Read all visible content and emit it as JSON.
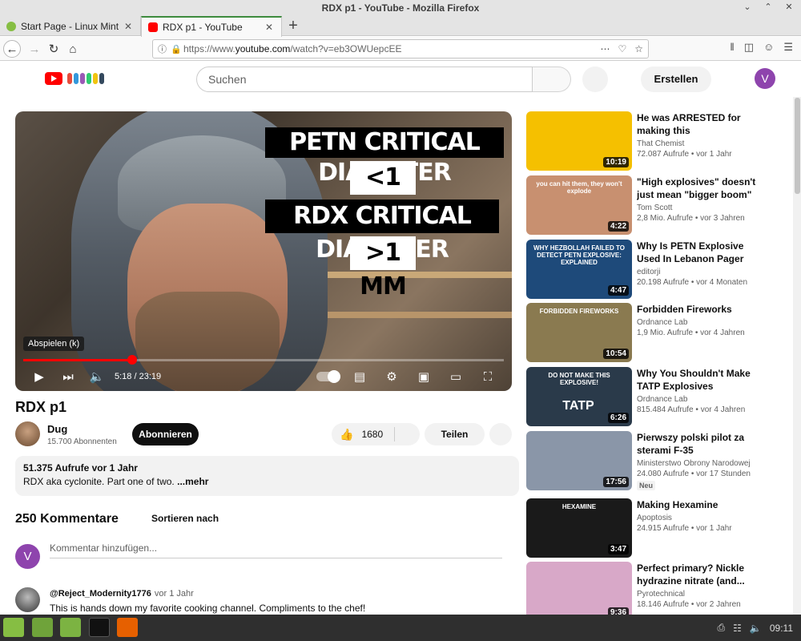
{
  "window": {
    "title": "RDX p1 - YouTube - Mozilla Firefox"
  },
  "browser": {
    "tabs": [
      {
        "label": "Start Page - Linux Mint",
        "active": false
      },
      {
        "label": "RDX p1 - YouTube",
        "active": true
      }
    ],
    "url_prefix": "https://www.",
    "url_domain": "youtube.com",
    "url_path": "/watch?v=eb3OWUepcEE"
  },
  "youtube": {
    "search_placeholder": "Suchen",
    "create_label": "Erstellen",
    "user_initial": "V"
  },
  "video": {
    "overlay_lines": [
      "PETN CRITICAL DIAMETER",
      "<1 MM",
      "RDX CRITICAL DIAMETER",
      ">1 MM"
    ],
    "tooltip": "Abspielen (k)",
    "time": "5:18 / 23:19",
    "progress": 0.2273,
    "title": "RDX p1"
  },
  "channel": {
    "name": "Dug",
    "subscribers": "15.700 Abonnenten",
    "subscribe_label": "Abonnieren"
  },
  "actions": {
    "likes": "1680",
    "share_label": "Teilen"
  },
  "description": {
    "meta": "51.375 Aufrufe  vor 1 Jahr",
    "text": "RDX aka cyclonite. Part one of two.",
    "more": "...mehr"
  },
  "comments": {
    "count": "250 Kommentare",
    "sort_label": "Sortieren nach",
    "input_placeholder": "Kommentar hinzufügen...",
    "user_initial": "V",
    "items": [
      {
        "user": "@Reject_Modernity1776",
        "time": "vor 1 Jahr",
        "text": "This is hands down my favorite cooking channel. Compliments to the chef!"
      }
    ]
  },
  "sidebar": [
    {
      "title": "He was ARRESTED for making this",
      "channel": "That Chemist",
      "views": "72.087 Aufrufe",
      "age": "vor 1 Jahr",
      "duration": "10:19",
      "thumb_color": "#f5c000",
      "badge": ""
    },
    {
      "title": "\"High explosives\" doesn't just mean \"bigger boom\"",
      "channel": "Tom Scott",
      "views": "2,8 Mio. Aufrufe",
      "age": "vor 3 Jahren",
      "duration": "4:22",
      "thumb_color": "#c89070",
      "badge": "",
      "thumb_text": "you can hit them, they won't explode"
    },
    {
      "title": "Why Is PETN Explosive Used In Lebanon Pager Blasts Hard T...",
      "channel": "editorji",
      "views": "20.198 Aufrufe",
      "age": "vor 4 Monaten",
      "duration": "4:47",
      "thumb_color": "#1e4a7a",
      "badge": "",
      "thumb_text": "WHY HEZBOLLAH FAILED TO DETECT PETN EXPLOSIVE: EXPLAINED"
    },
    {
      "title": "Forbidden Fireworks",
      "channel": "Ordnance Lab",
      "views": "1,9 Mio. Aufrufe",
      "age": "vor 4 Jahren",
      "duration": "10:54",
      "thumb_color": "#8a7a50",
      "badge": "",
      "thumb_text": "FORBIDDEN FIREWORKS"
    },
    {
      "title": "Why You Shouldn't Make TATP Explosives",
      "channel": "Ordnance Lab",
      "views": "815.484 Aufrufe",
      "age": "vor 4 Jahren",
      "duration": "6:26",
      "thumb_color": "#2a3a4a",
      "badge": "",
      "thumb_text": "DO NOT MAKE THIS EXPLOSIVE!",
      "thumb_text2": "TATP"
    },
    {
      "title": "Pierwszy polski pilot za sterami F-35",
      "channel": "Ministerstwo Obrony Narodowej",
      "views": "24.080 Aufrufe",
      "age": "vor 17 Stunden",
      "duration": "17:56",
      "thumb_color": "#8a96a8",
      "badge": "Neu"
    },
    {
      "title": "Making Hexamine",
      "channel": "Apoptosis",
      "views": "24.915 Aufrufe",
      "age": "vor 1 Jahr",
      "duration": "3:47",
      "thumb_color": "#1a1a1a",
      "badge": "",
      "thumb_text": "HEXAMINE"
    },
    {
      "title": "Perfect primary? Nickle hydrazine nitrate (and...",
      "channel": "Pyrotechnical",
      "views": "18.146 Aufrufe",
      "age": "vor 2 Jahren",
      "duration": "9:36",
      "thumb_color": "#d8a8c8",
      "badge": ""
    }
  ],
  "taskbar": {
    "clock": "09:11"
  }
}
